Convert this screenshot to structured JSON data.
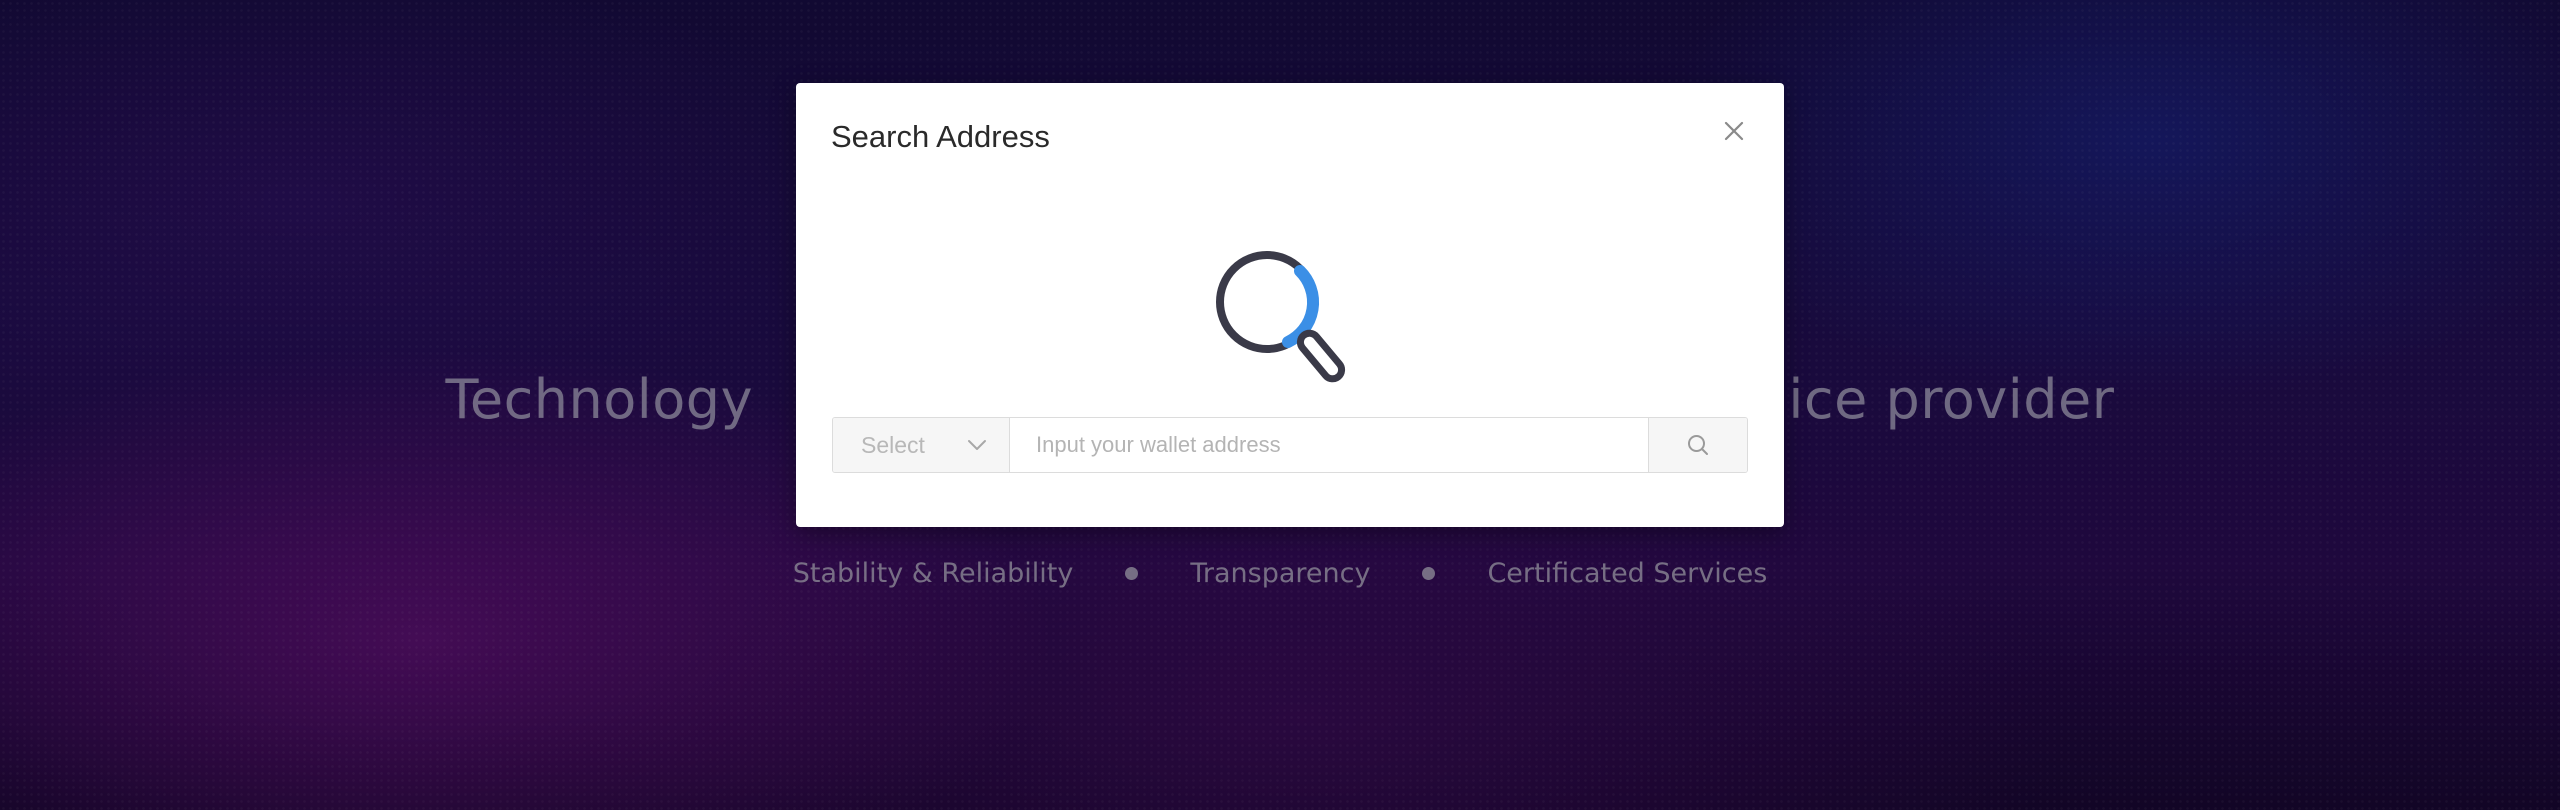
{
  "background": {
    "hero_title_left": "Technology",
    "hero_title_right": "ice provider",
    "features": [
      "Stability & Reliability",
      "Transparency",
      "Certificated Services"
    ]
  },
  "modal": {
    "title": "Search Address",
    "close_icon": "close-icon",
    "illustration_icon": "magnifier-icon",
    "select": {
      "label": "Select",
      "icon": "chevron-down-icon"
    },
    "input": {
      "value": "",
      "placeholder": "Input your wallet address"
    },
    "search_button_icon": "search-icon"
  },
  "colors": {
    "modal_bg": "#ffffff",
    "accent_blue": "#3b8fe6",
    "icon_dark": "#3a3a48"
  }
}
